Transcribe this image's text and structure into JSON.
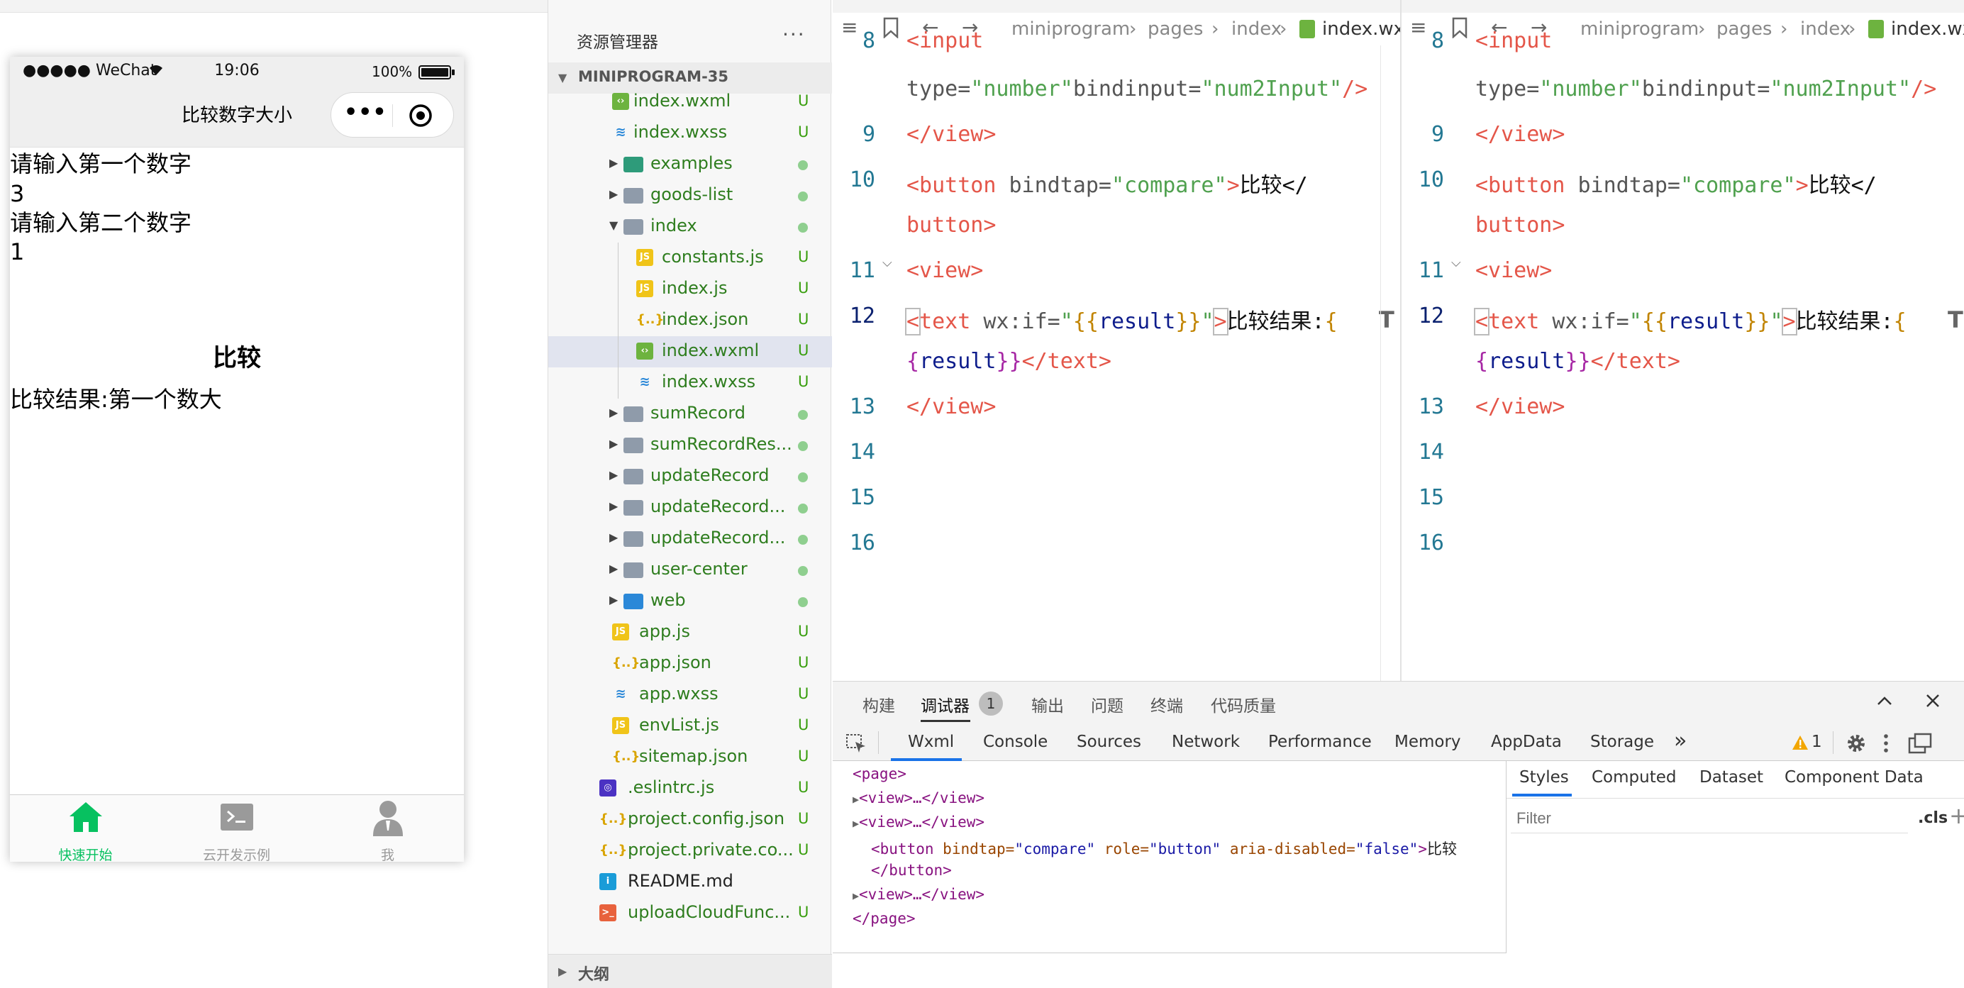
{
  "simulator": {
    "status": {
      "carrier": "●●●●● WeChat",
      "time": "19:06",
      "battery": "100%"
    },
    "nav_title": "比较数字大小",
    "capsule": {
      "more": "•••"
    },
    "lines": {
      "prompt1": "请输入第一个数字",
      "value1": "3",
      "prompt2": "请输入第二个数字",
      "value2": "1",
      "result": "比较结果:第一个数大"
    },
    "button_label": "比较",
    "tabs": [
      {
        "label": "快速开始",
        "icon": "home-icon",
        "active": true
      },
      {
        "label": "云开发示例",
        "icon": "terminal-icon",
        "active": false
      },
      {
        "label": "我",
        "icon": "person-icon",
        "active": false
      }
    ]
  },
  "explorer": {
    "title": "资源管理器",
    "more": "···",
    "project": "MINIPROGRAM-35",
    "outline": "大纲",
    "items": [
      {
        "name": "index.wxml",
        "badge": "U",
        "type": "wxml"
      },
      {
        "name": "index.wxss",
        "badge": "U",
        "type": "wxss"
      },
      {
        "name": "examples",
        "badge": "",
        "type": "folder-special"
      },
      {
        "name": "goods-list",
        "badge": "",
        "type": "folder"
      },
      {
        "name": "index",
        "badge": "",
        "type": "folder-open"
      },
      {
        "name": "constants.js",
        "badge": "U",
        "type": "js"
      },
      {
        "name": "index.js",
        "badge": "U",
        "type": "js"
      },
      {
        "name": "index.json",
        "badge": "U",
        "type": "json"
      },
      {
        "name": "index.wxml",
        "badge": "U",
        "type": "wxml"
      },
      {
        "name": "index.wxss",
        "badge": "U",
        "type": "wxss"
      },
      {
        "name": "sumRecord",
        "badge": "",
        "type": "folder"
      },
      {
        "name": "sumRecordRes...",
        "badge": "",
        "type": "folder"
      },
      {
        "name": "updateRecord",
        "badge": "",
        "type": "folder"
      },
      {
        "name": "updateRecord...",
        "badge": "",
        "type": "folder"
      },
      {
        "name": "updateRecord...",
        "badge": "",
        "type": "folder"
      },
      {
        "name": "user-center",
        "badge": "",
        "type": "folder"
      },
      {
        "name": "web",
        "badge": "",
        "type": "folder-web"
      },
      {
        "name": "app.js",
        "badge": "U",
        "type": "js"
      },
      {
        "name": "app.json",
        "badge": "U",
        "type": "json"
      },
      {
        "name": "app.wxss",
        "badge": "U",
        "type": "wxss"
      },
      {
        "name": "envList.js",
        "badge": "U",
        "type": "js"
      },
      {
        "name": "sitemap.json",
        "badge": "U",
        "type": "json"
      },
      {
        "name": ".eslintrc.js",
        "badge": "U",
        "type": "eslint"
      },
      {
        "name": "project.config.json",
        "badge": "U",
        "type": "json"
      },
      {
        "name": "project.private.co...",
        "badge": "U",
        "type": "json"
      },
      {
        "name": "README.md",
        "badge": "",
        "type": "info"
      },
      {
        "name": "uploadCloudFunc...",
        "badge": "U",
        "type": "shell"
      }
    ]
  },
  "editor": {
    "breadcrumb": [
      "miniprogram",
      "pages",
      "index",
      "index.wxml"
    ],
    "line_numbers": [
      "8",
      "9",
      "10",
      "11",
      "12",
      "13",
      "14",
      "15",
      "16"
    ],
    "code": {
      "l8a_tag": "<input",
      "l8b_attr": "type=",
      "l8b_str": "\"number\"",
      "l8b_attr2": "bindinput=",
      "l8b_str2": "\"num2Input\"",
      "l8b_end": "/>",
      "l9": "</view>",
      "l10_tag": "<button",
      "l10_attr": " bindtap=",
      "l10_str": "\"compare\"",
      "l10_gt": ">",
      "l10_txt": "比较</",
      "l10b": "button>",
      "l11": "<view>",
      "l12_lt": "<",
      "l12_tag": "text",
      "l12_attr": " wx:if=",
      "l12_q1": "\"",
      "l12_b1": "{{",
      "l12_expr": "result",
      "l12_b2": "}}",
      "l12_q2": "\"",
      "l12_gt": ">",
      "l12_txt": "比较结果:",
      "l12_b3": "{",
      "l12b_b": "{",
      "l12b_expr": "result",
      "l12b_b2": "}}",
      "l12b_tag": "</text>",
      "l13": "</view>"
    }
  },
  "panel": {
    "tabs": [
      "构建",
      "调试器",
      "输出",
      "问题",
      "终端",
      "代码质量"
    ],
    "debugger_badge": "1",
    "devtools_tabs": [
      "Wxml",
      "Console",
      "Sources",
      "Network",
      "Performance",
      "Memory",
      "AppData",
      "Storage"
    ],
    "more_tabs": "»",
    "warning_count": "1",
    "dom": {
      "page_open": "<page>",
      "view_collapsed": "<view>…</view>",
      "button_tag": "<button",
      "button_attr1": "bindtap=",
      "button_val1": "\"compare\"",
      "button_attr2": "role=",
      "button_val2": "\"button\"",
      "button_attr3": "aria-disabled=",
      "button_val3": "\"false\"",
      "button_text": "比较",
      "button_close": "</button>",
      "page_close": "</page>"
    },
    "style_tabs": [
      "Styles",
      "Computed",
      "Dataset",
      "Component Data"
    ],
    "filter_placeholder": "Filter",
    "cls": ".cls",
    "plus": "+"
  },
  "colors": {
    "wechat_green": "#07c160",
    "tree_green": "#389e0d",
    "tag_red": "#e45649",
    "string_gold": "#c18401",
    "string_green": "#50a14f",
    "line_number": "#237893"
  }
}
